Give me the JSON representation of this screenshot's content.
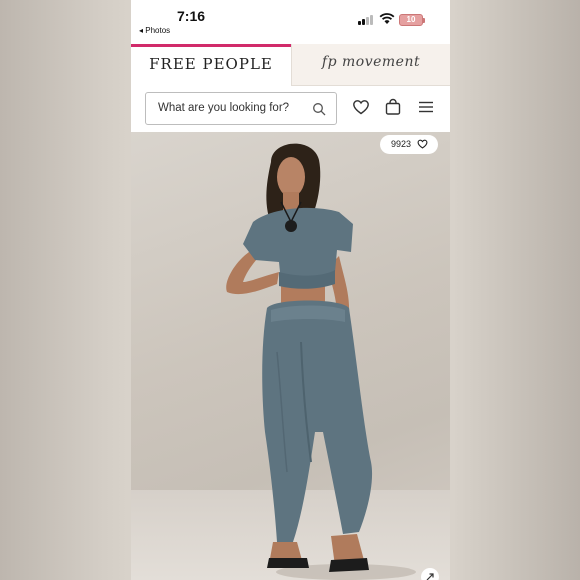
{
  "status_bar": {
    "time": "7:16",
    "back_label": "◂ Photos",
    "battery": "10"
  },
  "tabs": [
    {
      "label": "FREE PEOPLE",
      "active": true
    },
    {
      "label": "fp movement",
      "active": false
    }
  ],
  "header": {
    "search_placeholder": "What are you looking for?",
    "icons": [
      "search-icon",
      "heart-icon",
      "bag-icon",
      "menu-icon"
    ]
  },
  "product": {
    "likes": "9923"
  },
  "colors": {
    "accent": "#d12a6a",
    "outfit": "#5e7480"
  }
}
